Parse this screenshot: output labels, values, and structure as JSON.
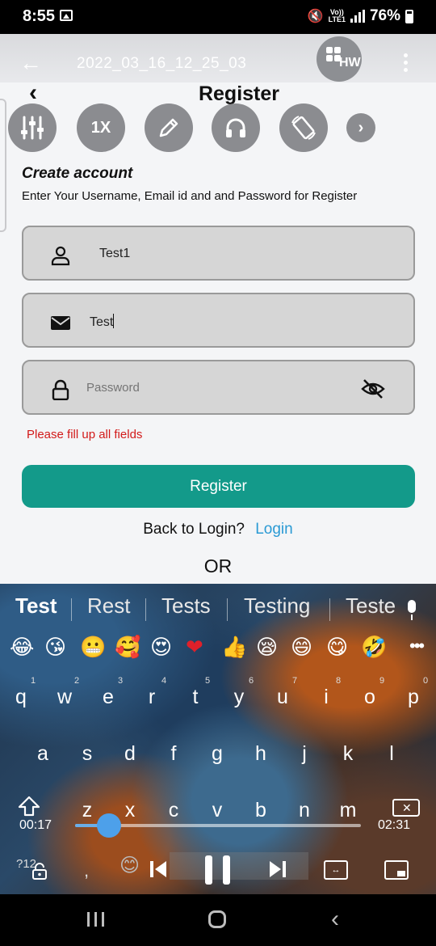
{
  "status_bar": {
    "time": "8:55",
    "volte": "Vo)) LTE1",
    "battery": "76%"
  },
  "player": {
    "file_title": "2022_03_16_12_25_03",
    "hw_label": "HW",
    "speed": "1X",
    "time_elapsed": "00:17",
    "time_total": "02:31",
    "progress_fraction": 0.12
  },
  "app": {
    "title": "Register",
    "create_title": "Create account",
    "create_subtitle": "Enter Your Username, Email id and  and Password for Register",
    "username_value": "Test1",
    "email_value": "Test",
    "password_placeholder": "Password",
    "error_message": "Please fill up all fields",
    "register_button": "Register",
    "back_to_login": "Back to Login?",
    "login_link": "Login",
    "or_text": "OR"
  },
  "keyboard": {
    "suggestions": [
      "Test",
      "Rest",
      "Tests",
      "Testing",
      "Teste"
    ],
    "emojis": [
      "😂",
      "😘",
      "😬",
      "🥰",
      "😍",
      "❤",
      "👍",
      "😪",
      "😄",
      "😋",
      "🤣"
    ],
    "row1": [
      "q",
      "w",
      "e",
      "r",
      "t",
      "y",
      "u",
      "i",
      "o",
      "p"
    ],
    "row1_hints": [
      "1",
      "2",
      "3",
      "4",
      "5",
      "6",
      "7",
      "8",
      "9",
      "0"
    ],
    "row2": [
      "a",
      "s",
      "d",
      "f",
      "g",
      "h",
      "j",
      "k",
      "l"
    ],
    "row3": [
      "z",
      "x",
      "c",
      "v",
      "b",
      "n",
      "m"
    ],
    "symbol_key": "?12",
    "comma_key": ",",
    "emoji_key": "😊"
  },
  "colors": {
    "accent": "#139a8a",
    "link": "#2a9ad4",
    "error": "#d21a1a",
    "seek": "#4da0ea"
  }
}
